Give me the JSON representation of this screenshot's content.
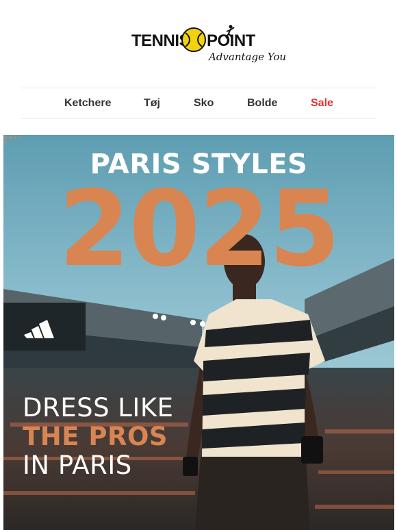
{
  "brand": {
    "name_left": "TENNIS",
    "name_right": "POINT",
    "tagline": "Advantage You",
    "colors": {
      "ball": "#f2d20f",
      "text": "#111111"
    }
  },
  "nav": {
    "items": [
      {
        "label": "Ketchere"
      },
      {
        "label": "Tøj"
      },
      {
        "label": "Sko"
      },
      {
        "label": "Bolde"
      },
      {
        "label": "Sale"
      }
    ],
    "sale_color": "#e4312f"
  },
  "hero": {
    "title": "PARIS STYLES",
    "year": "2025",
    "line1": "DRESS LIKE",
    "line2": "THE PROS",
    "line3": "IN PARIS",
    "accent_color": "#d98552"
  }
}
